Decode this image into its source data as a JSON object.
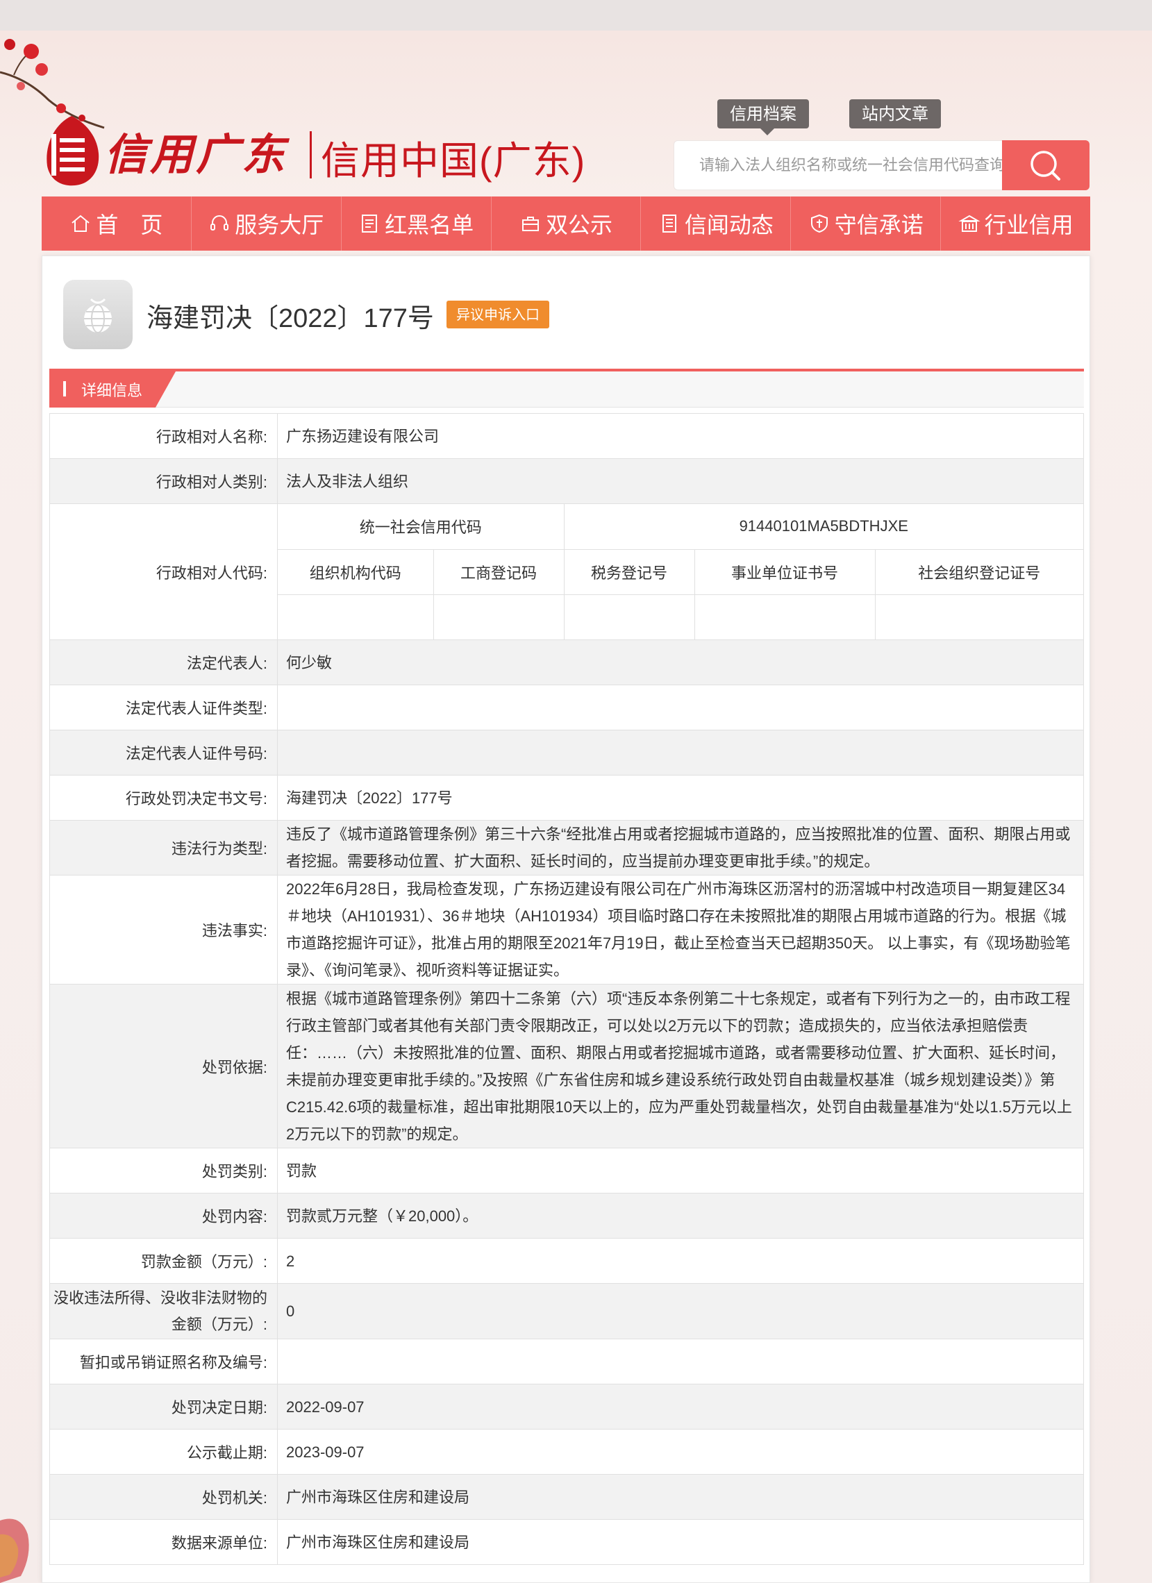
{
  "header": {
    "logo_script": "信用广东",
    "logo_title": "信用中国(广东)",
    "search_tabs": [
      "信用档案",
      "站内文章"
    ],
    "search_placeholder": "请输入法人组织名称或统一社会信用代码查询"
  },
  "nav": {
    "items": [
      {
        "label": "首　页",
        "icon": "home-icon"
      },
      {
        "label": "服务大厅",
        "icon": "headset-icon"
      },
      {
        "label": "红黑名单",
        "icon": "list-icon"
      },
      {
        "label": "双公示",
        "icon": "briefcase-icon"
      },
      {
        "label": "信闻动态",
        "icon": "document-icon"
      },
      {
        "label": "守信承诺",
        "icon": "shield-icon"
      },
      {
        "label": "行业信用",
        "icon": "building-icon"
      }
    ]
  },
  "record": {
    "title": "海建罚决〔2022〕177号",
    "appeal_label": "异议申诉入口",
    "section_label": "详细信息"
  },
  "codes": {
    "usc_label": "统一社会信用代码",
    "usc_value": "91440101MA5BDTHJXE",
    "columns": [
      "组织机构代码",
      "工商登记码",
      "税务登记号",
      "事业单位证书号",
      "社会组织登记证号"
    ],
    "values": [
      "",
      "",
      "",
      "",
      ""
    ]
  },
  "rows": {
    "party_name_label": "行政相对人名称:",
    "party_name": "广东扬迈建设有限公司",
    "party_type_label": "行政相对人类别:",
    "party_type": "法人及非法人组织",
    "party_code_label": "行政相对人代码:",
    "legal_rep_label": "法定代表人:",
    "legal_rep": "何少敏",
    "rep_id_type_label": "法定代表人证件类型:",
    "rep_id_type": "",
    "rep_id_no_label": "法定代表人证件号码:",
    "rep_id_no": "",
    "doc_no_label": "行政处罚决定书文号:",
    "doc_no": "海建罚决〔2022〕177号",
    "violation_type_label": "违法行为类型:",
    "violation_type": "违反了《城市道路管理条例》第三十六条“经批准占用或者挖掘城市道路的，应当按照批准的位置、面积、期限占用或者挖掘。需要移动位置、扩大面积、延长时间的，应当提前办理变更审批手续。”的规定。",
    "facts_label": "违法事实:",
    "facts": "2022年6月28日，我局检查发现，广东扬迈建设有限公司在广州市海珠区沥滘村的沥滘城中村改造项目一期复建区34＃地块（AH101931）、36＃地块（AH101934）项目临时路口存在未按照批准的期限占用城市道路的行为。根据《城市道路挖掘许可证》，批准占用的期限至2021年7月19日，截止至检查当天已超期350天。 以上事实，有《现场勘验笔录》、《询问笔录》、视听资料等证据证实。",
    "basis_label": "处罚依据:",
    "basis": "根据《城市道路管理条例》第四十二条第（六）项“违反本条例第二十七条规定，或者有下列行为之一的，由市政工程行政主管部门或者其他有关部门责令限期改正，可以处以2万元以下的罚款；造成损失的，应当依法承担赔偿责任：……（六）未按照批准的位置、面积、期限占用或者挖掘城市道路，或者需要移动位置、扩大面积、延长时间，未提前办理变更审批手续的。”及按照《广东省住房和城乡建设系统行政处罚自由裁量权基准（城乡规划建设类）》第C215.42.6项的裁量标准，超出审批期限10天以上的，应为严重处罚裁量档次，处罚自由裁量基准为“处以1.5万元以上2万元以下的罚款”的规定。",
    "penalty_type_label": "处罚类别:",
    "penalty_type": "罚款",
    "penalty_content_label": "处罚内容:",
    "penalty_content": "罚款贰万元整（￥20,000）。",
    "fine_label": "罚款金额（万元）:",
    "fine": "2",
    "confiscation_label_1": "没收违法所得、没收非法财物的",
    "confiscation_label_2": "金额（万元）:",
    "confiscation": "0",
    "license_label": "暂扣或吊销证照名称及编号:",
    "license": "",
    "decision_date_label": "处罚决定日期:",
    "decision_date": "2022-09-07",
    "publicity_end_label": "公示截止期:",
    "publicity_end": "2023-09-07",
    "authority_label": "处罚机关:",
    "authority": "广州市海珠区住房和建设局",
    "source_label": "数据来源单位:",
    "source": "广州市海珠区住房和建设局"
  },
  "colors": {
    "brand_red": "#c8171e",
    "nav_bg": "#f0605e",
    "appeal_orange": "#f08c2d",
    "tab_gray": "#6d6766"
  }
}
